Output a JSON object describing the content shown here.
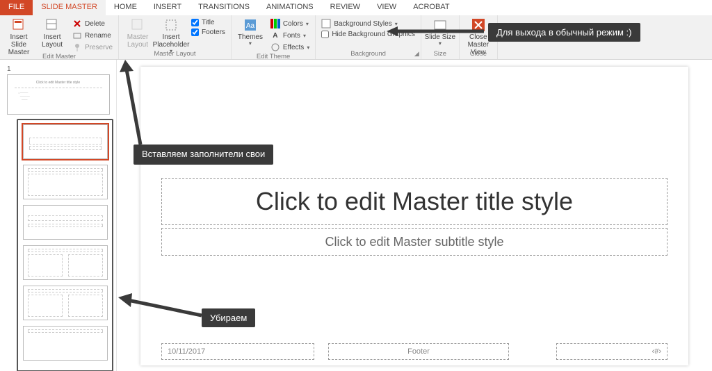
{
  "tabs": {
    "file": "FILE",
    "slide_master": "SLIDE MASTER",
    "home": "HOME",
    "insert": "INSERT",
    "transitions": "TRANSITIONS",
    "animations": "ANIMATIONS",
    "review": "REVIEW",
    "view": "VIEW",
    "acrobat": "ACROBAT"
  },
  "groups": {
    "edit_master": {
      "label": "Edit Master",
      "insert_slide_master": "Insert Slide Master",
      "insert_layout": "Insert Layout",
      "delete": "Delete",
      "rename": "Rename",
      "preserve": "Preserve"
    },
    "master_layout": {
      "label": "Master Layout",
      "master_layout_btn": "Master Layout",
      "insert_placeholder": "Insert Placeholder",
      "title_chk": "Title",
      "footers_chk": "Footers"
    },
    "edit_theme": {
      "label": "Edit Theme",
      "themes": "Themes",
      "colors": "Colors",
      "fonts": "Fonts",
      "effects": "Effects"
    },
    "background": {
      "label": "Background",
      "styles": "Background Styles",
      "hide": "Hide Background Graphics"
    },
    "size": {
      "label": "Size",
      "slide_size": "Slide Size"
    },
    "close": {
      "label": "Close",
      "close_btn": "Close Master View"
    }
  },
  "thumbs": {
    "slidenum": "1",
    "master_text": "Click to edit Master title style"
  },
  "canvas": {
    "title": "Click to edit Master title style",
    "subtitle": "Click to edit Master subtitle style",
    "date": "10/11/2017",
    "footer": "Footer",
    "number": "‹#›"
  },
  "callouts": {
    "close_tip": "Для выхода в обычный режим :)",
    "insert_tip": "Вставляем заполнители свои",
    "remove_tip": "Убираем"
  }
}
